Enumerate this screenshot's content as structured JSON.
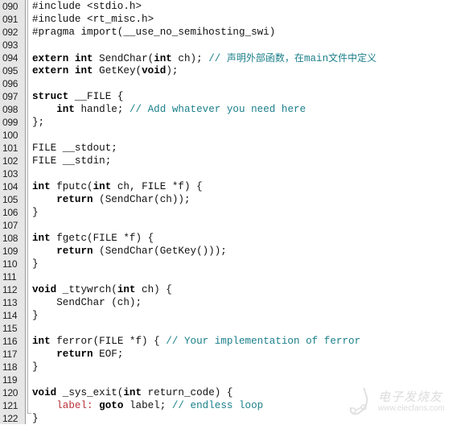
{
  "editor": {
    "lines": [
      {
        "num": "090",
        "parts": [
          {
            "t": "#include <stdio.h>",
            "c": ""
          }
        ]
      },
      {
        "num": "091",
        "parts": [
          {
            "t": "#include <rt_misc.h>",
            "c": ""
          }
        ]
      },
      {
        "num": "092",
        "parts": [
          {
            "t": "#pragma import(__use_no_semihosting_swi)",
            "c": ""
          }
        ]
      },
      {
        "num": "093",
        "parts": []
      },
      {
        "num": "094",
        "parts": [
          {
            "t": "extern",
            "c": "kw"
          },
          {
            "t": " ",
            "c": ""
          },
          {
            "t": "int",
            "c": "kw"
          },
          {
            "t": " SendChar(",
            "c": ""
          },
          {
            "t": "int",
            "c": "kw"
          },
          {
            "t": " ch); ",
            "c": ""
          },
          {
            "t": "// ",
            "c": "cm"
          },
          {
            "t": "声明外部函数，在",
            "c": "cm cn"
          },
          {
            "t": "main",
            "c": "cm"
          },
          {
            "t": "文件中定义",
            "c": "cm cn"
          }
        ]
      },
      {
        "num": "095",
        "parts": [
          {
            "t": "extern",
            "c": "kw"
          },
          {
            "t": " ",
            "c": ""
          },
          {
            "t": "int",
            "c": "kw"
          },
          {
            "t": " GetKey(",
            "c": ""
          },
          {
            "t": "void",
            "c": "kw"
          },
          {
            "t": ");",
            "c": ""
          }
        ]
      },
      {
        "num": "096",
        "parts": []
      },
      {
        "num": "097",
        "parts": [
          {
            "t": "struct",
            "c": "kw"
          },
          {
            "t": " __FILE {",
            "c": ""
          }
        ]
      },
      {
        "num": "098",
        "parts": [
          {
            "t": "    ",
            "c": ""
          },
          {
            "t": "int",
            "c": "kw"
          },
          {
            "t": " handle; ",
            "c": ""
          },
          {
            "t": "// Add whatever you need here",
            "c": "cm"
          }
        ]
      },
      {
        "num": "099",
        "parts": [
          {
            "t": "};",
            "c": ""
          }
        ]
      },
      {
        "num": "100",
        "parts": []
      },
      {
        "num": "101",
        "parts": [
          {
            "t": "FILE __stdout;",
            "c": ""
          }
        ]
      },
      {
        "num": "102",
        "parts": [
          {
            "t": "FILE __stdin;",
            "c": ""
          }
        ]
      },
      {
        "num": "103",
        "parts": []
      },
      {
        "num": "104",
        "parts": [
          {
            "t": "int",
            "c": "kw"
          },
          {
            "t": " fputc(",
            "c": ""
          },
          {
            "t": "int",
            "c": "kw"
          },
          {
            "t": " ch, FILE *f) {",
            "c": ""
          }
        ]
      },
      {
        "num": "105",
        "parts": [
          {
            "t": "    ",
            "c": ""
          },
          {
            "t": "return",
            "c": "kw"
          },
          {
            "t": " (SendChar(ch));",
            "c": ""
          }
        ]
      },
      {
        "num": "106",
        "parts": [
          {
            "t": "}",
            "c": ""
          }
        ]
      },
      {
        "num": "107",
        "parts": []
      },
      {
        "num": "108",
        "parts": [
          {
            "t": "int",
            "c": "kw"
          },
          {
            "t": " fgetc(FILE *f) {",
            "c": ""
          }
        ]
      },
      {
        "num": "109",
        "parts": [
          {
            "t": "    ",
            "c": ""
          },
          {
            "t": "return",
            "c": "kw"
          },
          {
            "t": " (SendChar(GetKey()));",
            "c": ""
          }
        ]
      },
      {
        "num": "110",
        "parts": [
          {
            "t": "}",
            "c": ""
          }
        ]
      },
      {
        "num": "111",
        "parts": []
      },
      {
        "num": "112",
        "parts": [
          {
            "t": "void",
            "c": "kw"
          },
          {
            "t": " _ttywrch(",
            "c": ""
          },
          {
            "t": "int",
            "c": "kw"
          },
          {
            "t": " ch) {",
            "c": ""
          }
        ]
      },
      {
        "num": "113",
        "parts": [
          {
            "t": "    SendChar (ch);",
            "c": ""
          }
        ]
      },
      {
        "num": "114",
        "parts": [
          {
            "t": "}",
            "c": ""
          }
        ]
      },
      {
        "num": "115",
        "parts": []
      },
      {
        "num": "116",
        "parts": [
          {
            "t": "int",
            "c": "kw"
          },
          {
            "t": " ferror(FILE *f) { ",
            "c": ""
          },
          {
            "t": "// Your implementation of ferror",
            "c": "cm"
          }
        ]
      },
      {
        "num": "117",
        "parts": [
          {
            "t": "    ",
            "c": ""
          },
          {
            "t": "return",
            "c": "kw"
          },
          {
            "t": " EOF;",
            "c": ""
          }
        ]
      },
      {
        "num": "118",
        "parts": [
          {
            "t": "}",
            "c": ""
          }
        ]
      },
      {
        "num": "119",
        "parts": []
      },
      {
        "num": "120",
        "parts": [
          {
            "t": "void",
            "c": "kw"
          },
          {
            "t": " _sys_exit(",
            "c": ""
          },
          {
            "t": "int",
            "c": "kw"
          },
          {
            "t": " return_code) {",
            "c": ""
          }
        ]
      },
      {
        "num": "121",
        "parts": [
          {
            "t": "    ",
            "c": ""
          },
          {
            "t": "label:",
            "c": "lbl"
          },
          {
            "t": " ",
            "c": ""
          },
          {
            "t": "goto",
            "c": "kw"
          },
          {
            "t": " label; ",
            "c": ""
          },
          {
            "t": "// endless loop",
            "c": "cm"
          }
        ]
      },
      {
        "num": "122",
        "parts": [
          {
            "t": "}",
            "c": ""
          }
        ]
      }
    ]
  },
  "watermark": {
    "title": "电子发烧友",
    "url": "www.elecfans.com",
    "icon": "elecfans-logo-icon"
  },
  "colors": {
    "keyword": "#000000",
    "comment": "#1a7f8a",
    "label": "#b8323a",
    "text": "#111111",
    "gutter": "#ececec"
  }
}
